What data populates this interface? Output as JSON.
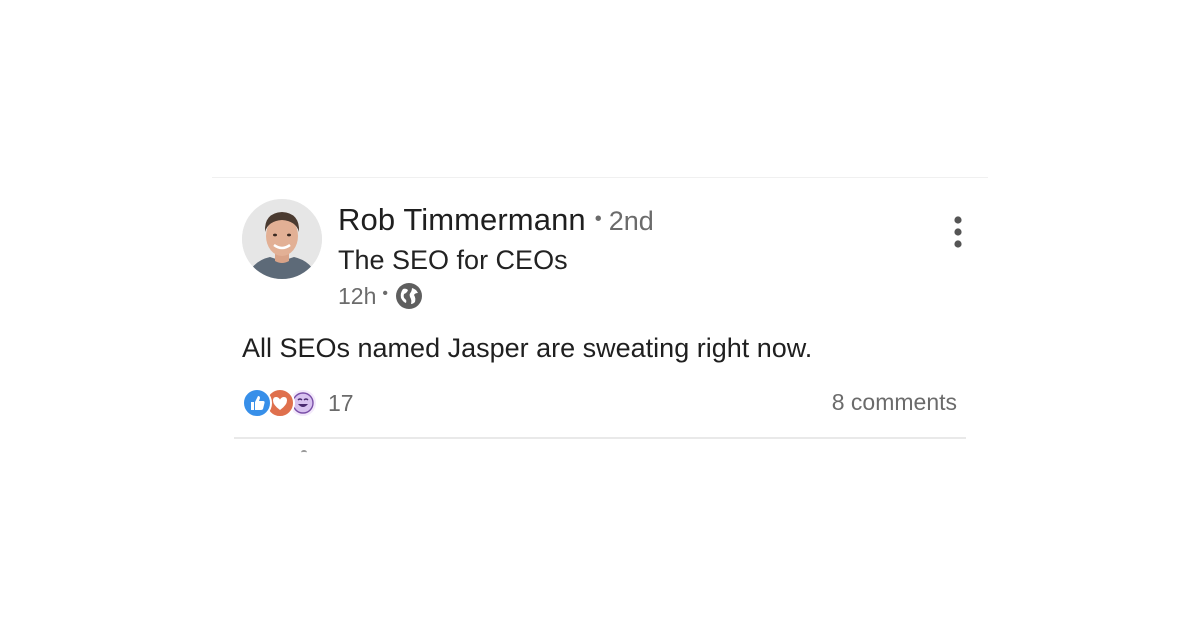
{
  "post": {
    "author": {
      "name": "Rob Timmermann",
      "separator": "•",
      "connection_degree": "2nd",
      "headline": "The SEO for CEOs",
      "avatar_icon": "profile-photo"
    },
    "timestamp": "12h",
    "meta_separator": "•",
    "visibility_icon": "globe-icon",
    "more_icon": "vertical-ellipsis-icon",
    "text": "All SEOs named Jasper are sweating right now.",
    "reactions": {
      "icons": [
        "like-icon",
        "love-icon",
        "funny-icon"
      ],
      "count": "17"
    },
    "comments_label": "8 comments"
  },
  "colors": {
    "like": "#378fe9",
    "love": "#df704d",
    "funny": "#d8c2f0",
    "muted_text": "#6b6b6b",
    "primary_text": "#1f1f1f"
  }
}
